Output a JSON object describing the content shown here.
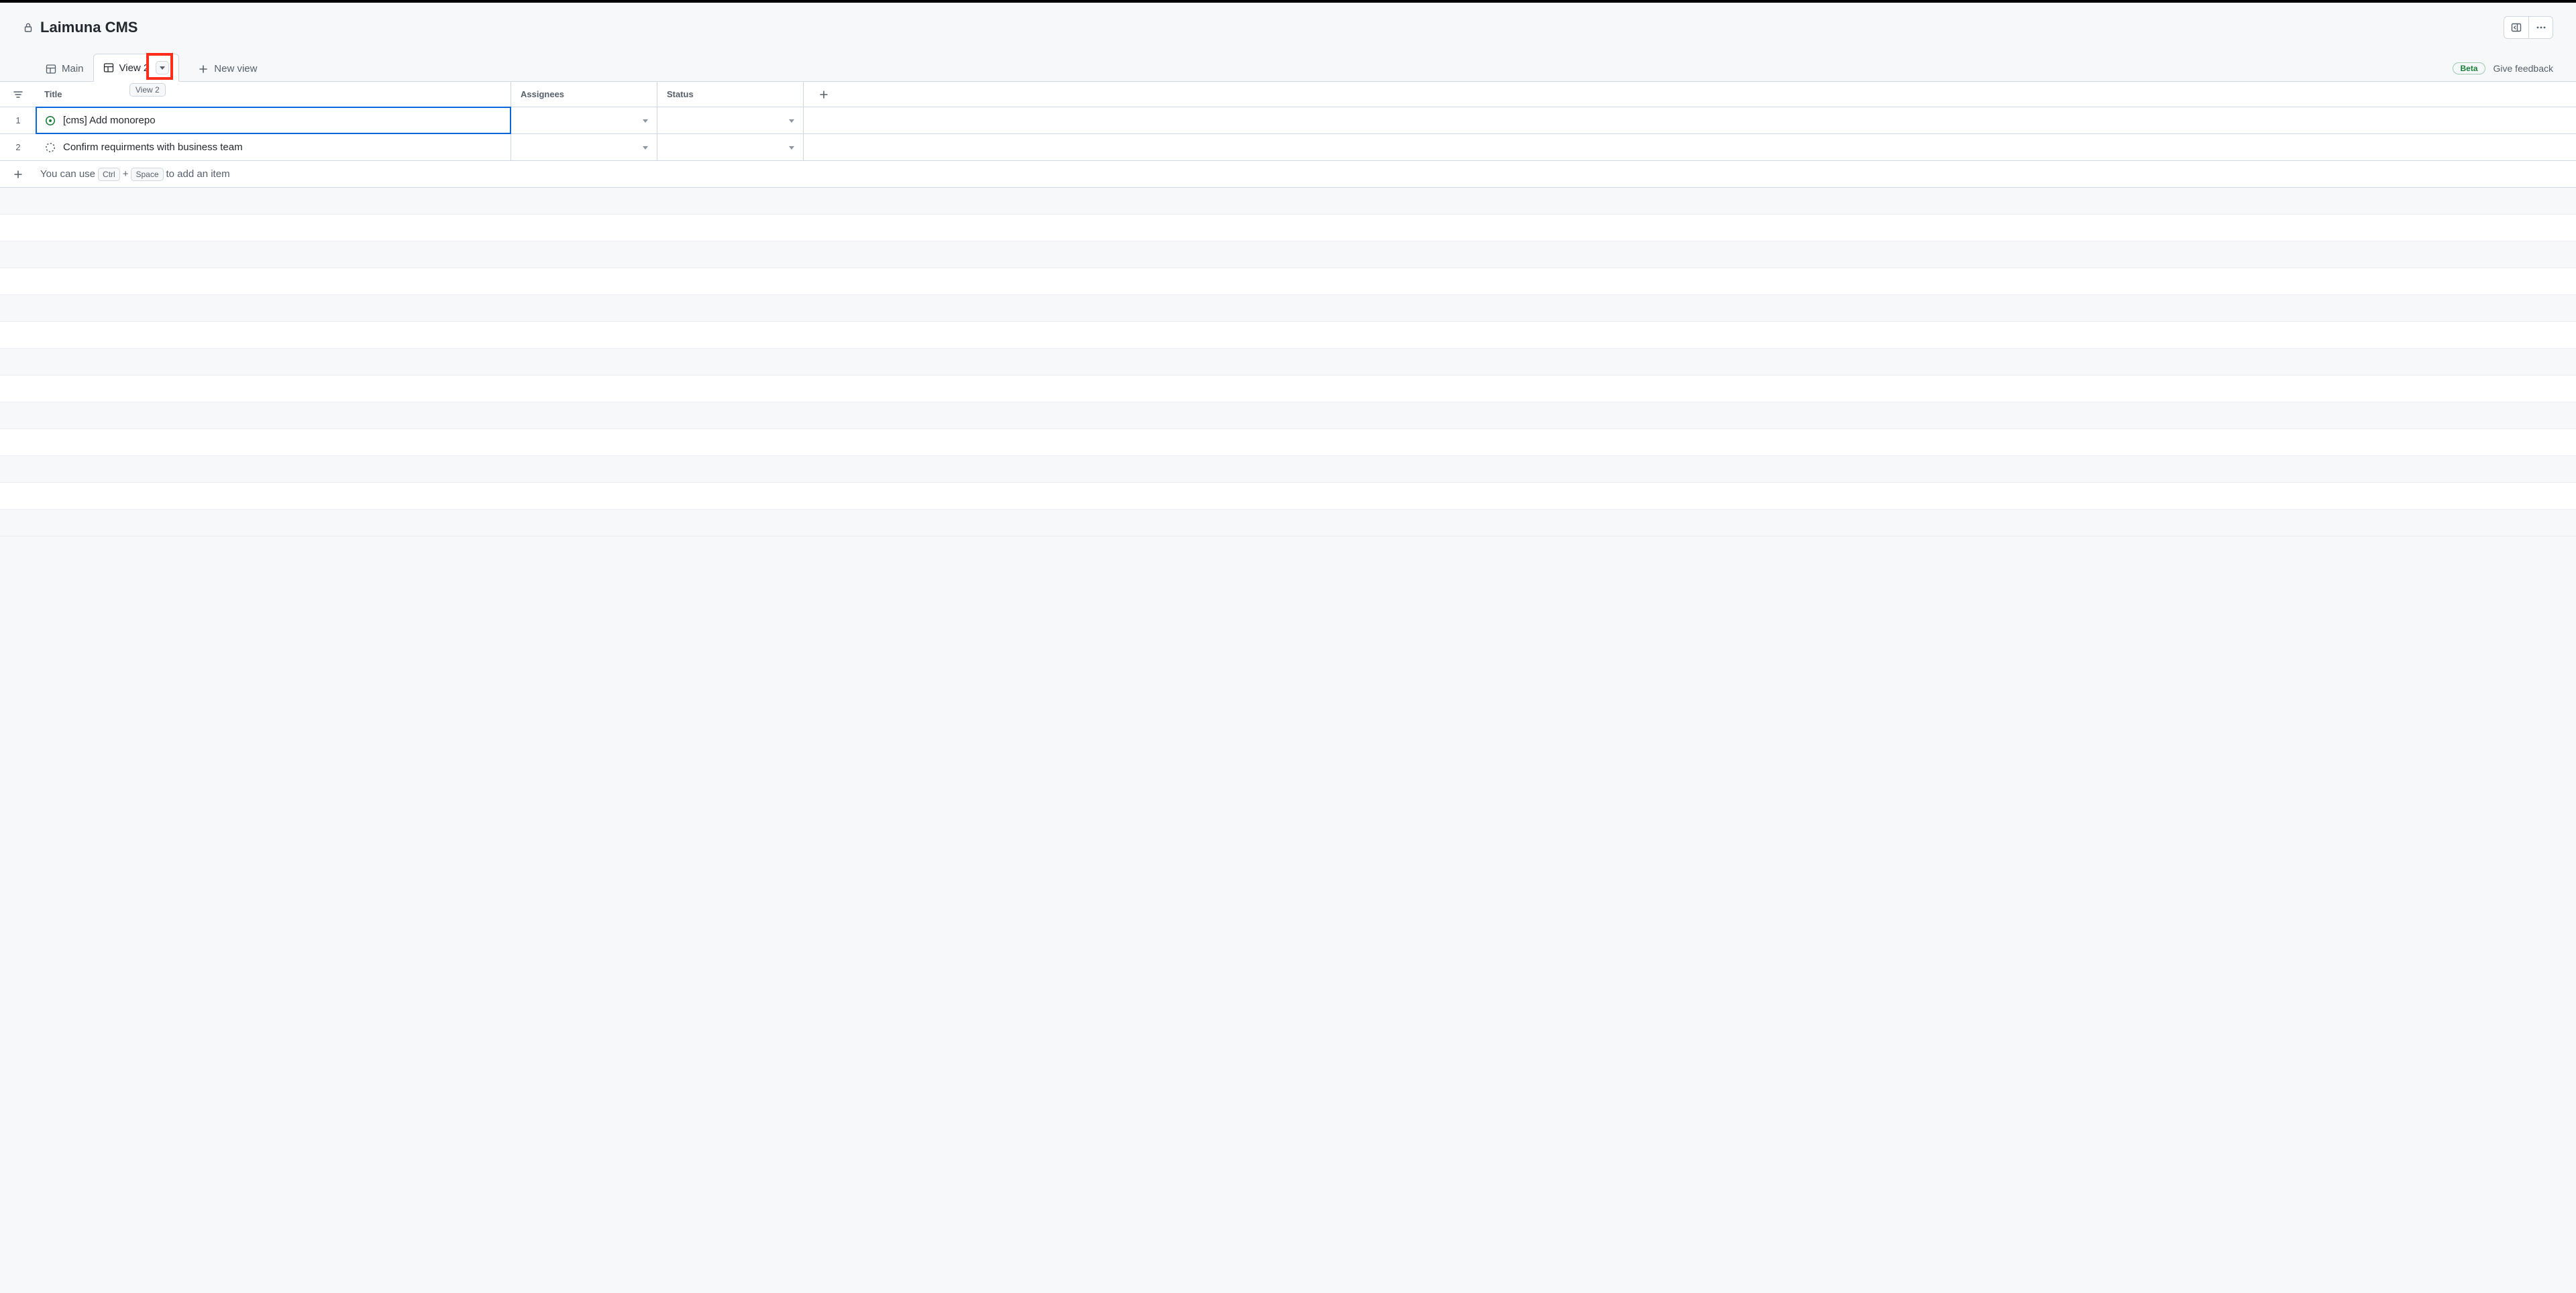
{
  "project": {
    "title": "Laimuna CMS"
  },
  "tabs": {
    "main_label": "Main",
    "view2_label": "View 2",
    "view2_tooltip": "View 2",
    "new_view_label": "New view"
  },
  "header_right": {
    "beta_label": "Beta",
    "feedback_label": "Give feedback"
  },
  "columns": {
    "title_label": "Title",
    "assignees_label": "Assignees",
    "status_label": "Status"
  },
  "rows": [
    {
      "num": "1",
      "title": "[cms] Add monorepo",
      "icon": "issue-open",
      "selected": true
    },
    {
      "num": "2",
      "title": "Confirm requirments with business team",
      "icon": "draft",
      "selected": false
    }
  ],
  "add_item": {
    "prefix": "You can use",
    "key1": "Ctrl",
    "plus": "+",
    "key2": "Space",
    "suffix": "to add an item"
  }
}
